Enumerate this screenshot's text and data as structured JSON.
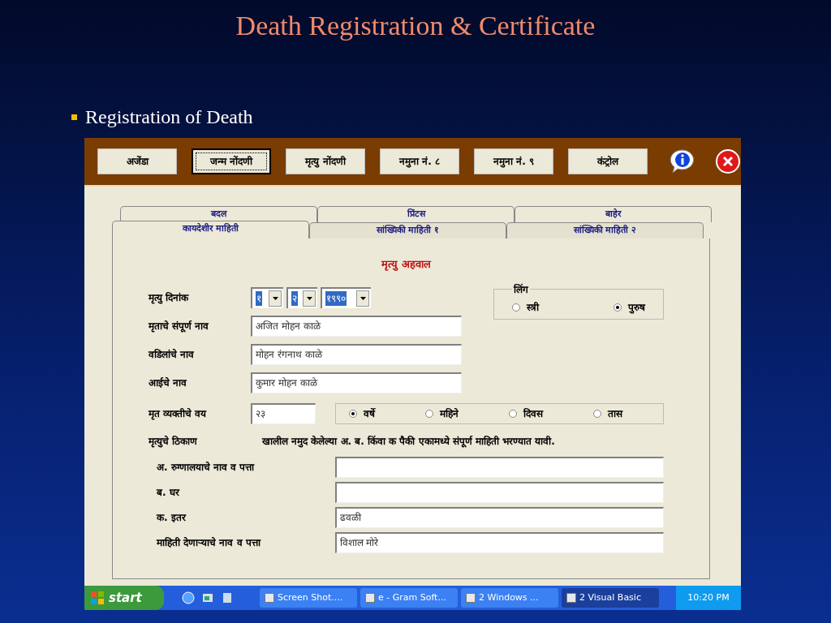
{
  "slide": {
    "title": "Death Registration & Certificate",
    "bullet": "Registration of  Death"
  },
  "toolbar": {
    "buttons": [
      {
        "label": "अजेंडा",
        "focused": false
      },
      {
        "label": "जन्म नोंदणी",
        "focused": true
      },
      {
        "label": "मृत्यु नोंदणी",
        "focused": false
      },
      {
        "label": "नमुना नं. ८",
        "focused": false
      },
      {
        "label": "नमुना नं. ९",
        "focused": false
      },
      {
        "label": "कंट्रोल",
        "focused": false
      }
    ]
  },
  "tabs_back": [
    {
      "label": "बदल",
      "selected": false
    },
    {
      "label": "प्रिंटस",
      "selected": false
    },
    {
      "label": "बाहेर",
      "selected": false
    }
  ],
  "tabs_front": [
    {
      "label": "कायदेशीर माहिती",
      "selected": true
    },
    {
      "label": "सांख्यिकी माहिती १",
      "selected": false
    },
    {
      "label": "सांख्यिकी माहिती २",
      "selected": false
    }
  ],
  "form": {
    "heading": "मृत्यु अहवाल",
    "date": {
      "label": "मृत्यु दिनांक",
      "day": "१",
      "month": "२",
      "year": "१९९०"
    },
    "gender": {
      "label": "लिंग",
      "options": [
        {
          "label": "स्त्री",
          "selected": false
        },
        {
          "label": "पुरुष",
          "selected": true
        }
      ]
    },
    "names": [
      {
        "label": "मृताचे संपूर्ण नाव",
        "value": "अजित मोहन काळे"
      },
      {
        "label": "वडिलांचे नाव",
        "value": "मोहन रंगनाथ काळे"
      },
      {
        "label": "आईचे नाव",
        "value": "कुमार मोहन काळे"
      }
    ],
    "age": {
      "label": "मृत व्यक्तीचे वय",
      "value": "२३",
      "units": [
        {
          "label": "वर्षे",
          "selected": true
        },
        {
          "label": "महिने",
          "selected": false
        },
        {
          "label": "दिवस",
          "selected": false
        },
        {
          "label": "तास",
          "selected": false
        }
      ]
    },
    "place": {
      "label": "मृत्युचे ठिकाण",
      "note": "खालील नमुद केलेल्या अ. ब. किंवा क पैकी एकामध्ये संपूर्ण माहिती भरण्यात यावी."
    },
    "place_fields": [
      {
        "label": "अ. रुग्णालयाचे नाव व पत्ता"
      },
      {
        "label": "ब. घर"
      },
      {
        "label": "क. इतर",
        "value": "ढवळी"
      },
      {
        "label": "माहिती देणाऱ्याचे नाव व पत्ता",
        "value": "विशाल मोरे"
      }
    ]
  },
  "taskbar": {
    "start": "start",
    "items": [
      {
        "label": "Screen Shot....",
        "selected": false
      },
      {
        "label": "e - Gram Soft...",
        "selected": false
      },
      {
        "label": "2 Windows ...",
        "selected": false
      },
      {
        "label": "2 Visual Basic",
        "selected": true
      }
    ],
    "clock": "10:20 PM"
  }
}
